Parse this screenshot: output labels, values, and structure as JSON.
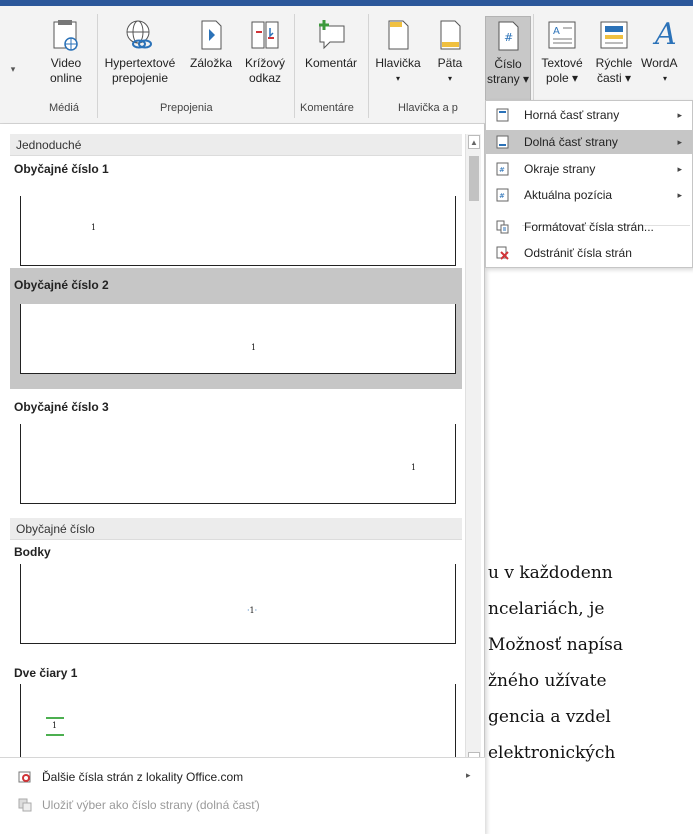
{
  "ribbon": {
    "groups": {
      "media": "Médiá",
      "links": "Prepojenia",
      "comment": "Komentáre",
      "header_footer": "Hlavička a p"
    },
    "buttons": {
      "video_line1": "Video",
      "video_line2": "online",
      "hyperlink_line1": "Hypertextové",
      "hyperlink_line2": "prepojenie",
      "bookmark": "Záložka",
      "crossref_line1": "Krížový",
      "crossref_line2": "odkaz",
      "comment": "Komentár",
      "header": "Hlavička",
      "footer": "Päta",
      "page_number_line1": "Číslo",
      "page_number_line2": "strany ▾",
      "textbox_line1": "Textové",
      "textbox_line2": "pole ▾",
      "quickparts_line1": "Rýchle",
      "quickparts_line2": "časti ▾",
      "wordart": "WordA"
    }
  },
  "gallery": {
    "section1": "Jednoduché",
    "section2": "Obyčajné číslo",
    "items": [
      {
        "title": "Obyčajné číslo 1",
        "num": "1"
      },
      {
        "title": "Obyčajné číslo 2",
        "num": "1"
      },
      {
        "title": "Obyčajné číslo 3",
        "num": "1"
      },
      {
        "title": "Bodky",
        "num": "1"
      },
      {
        "title": "Dve čiary 1",
        "num": "1"
      }
    ],
    "bottom": {
      "more": "Ďalšie čísla strán z lokality Office.com",
      "save": "Uložiť výber ako číslo strany (dolná časť)"
    }
  },
  "submenu": {
    "items": [
      {
        "label": "Horná časť strany"
      },
      {
        "label": "Dolná časť strany"
      },
      {
        "label": "Okraje strany"
      },
      {
        "label": "Aktuálna pozícia"
      },
      {
        "label": "Formátovať čísla strán..."
      },
      {
        "label": "Odstrániť čísla strán"
      }
    ]
  },
  "document": {
    "lines": [
      "u v každodenn",
      "ncelariách, je",
      "Možnosť napísa",
      "žného užívate",
      "gencia a vzdel",
      "elektronických"
    ]
  },
  "colors": {
    "accent": "#2b579a",
    "selection": "#c6c6c6",
    "submenu_highlight": "#c6c6c6"
  }
}
